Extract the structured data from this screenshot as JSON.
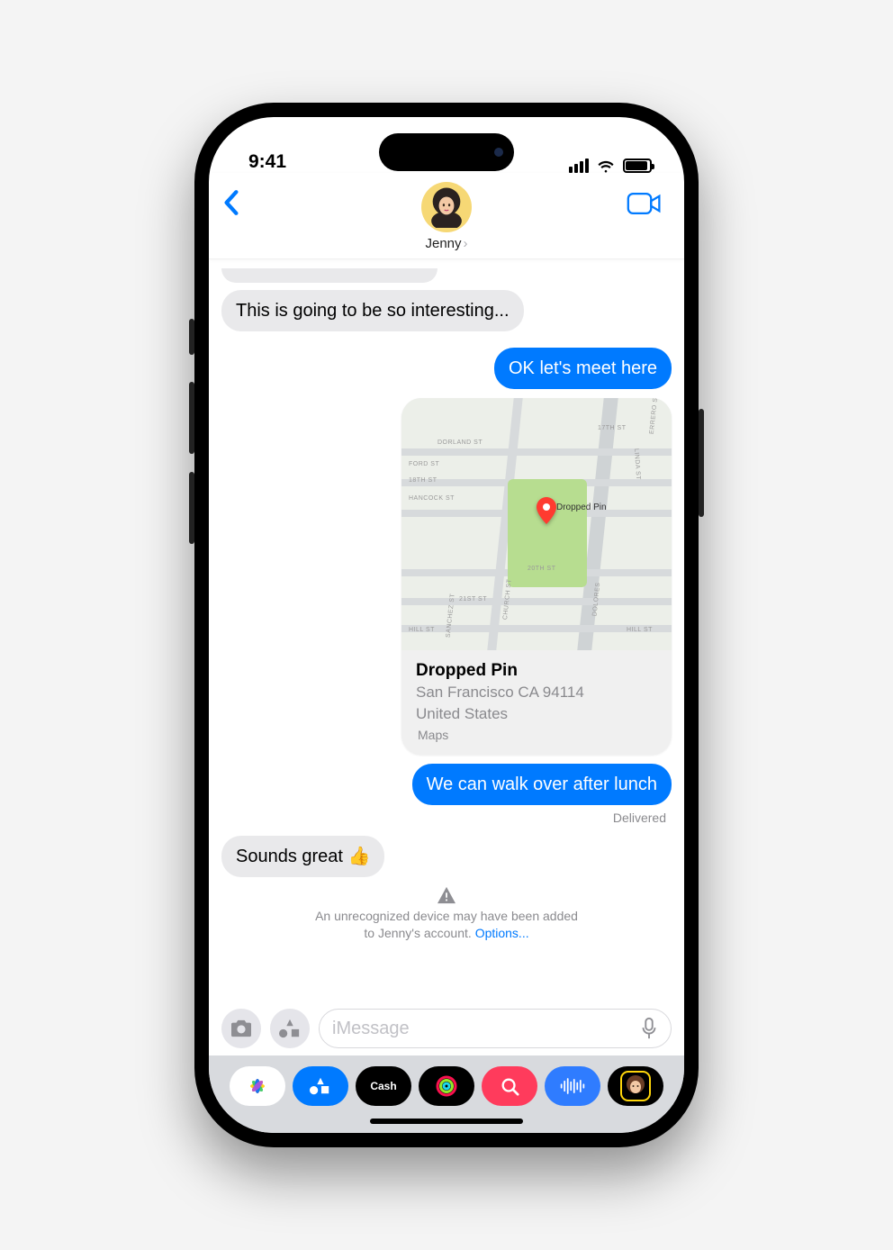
{
  "status": {
    "time": "9:41"
  },
  "header": {
    "contact_name": "Jenny"
  },
  "messages": {
    "in1": "This is going to be so interesting...",
    "out1": "OK let's meet here",
    "out2": "We can walk over after lunch",
    "in2": "Sounds great 👍",
    "delivered": "Delivered"
  },
  "map": {
    "pin_label": "Dropped Pin",
    "title": "Dropped Pin",
    "address_line1": "San Francisco CA 94114",
    "address_line2": "United States",
    "app": "Maps",
    "streets": {
      "dorland": "DORLAND ST",
      "ford": "FORD ST",
      "eighteenth": "18TH ST",
      "hancock": "HANCOCK ST",
      "twentieth": "20TH ST",
      "twentyfirst": "21ST ST",
      "hill": "HILL ST",
      "seventeenth": "17TH ST",
      "linda": "LINDA ST",
      "dolores": "DOLORES",
      "church": "CHURCH ST",
      "sanchez": "SANCHEZ ST",
      "errero": "ERRERO ST"
    }
  },
  "alert": {
    "line1": "An unrecognized device may have been added",
    "line2_prefix": "to Jenny's account. ",
    "options": "Options..."
  },
  "input": {
    "placeholder": "iMessage"
  },
  "drawer": {
    "cash": "Cash"
  }
}
